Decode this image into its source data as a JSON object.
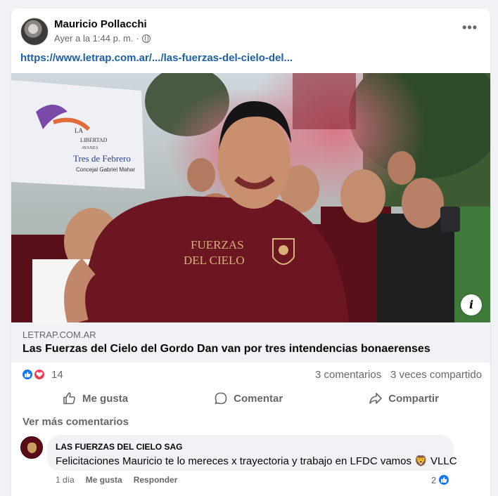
{
  "post": {
    "author": "Mauricio Pollacchi",
    "time": "Ayer a la 1:44 p. m.",
    "separator": "·",
    "privacy_icon": "globe-icon",
    "menu_icon": "more-options-icon",
    "link_text": "https://www.letrap.com.ar/.../las-fuerzas-del-cielo-del..."
  },
  "image": {
    "banner_lines": [
      "LA",
      "LIBERTAD",
      "AVANZA",
      "Tres de Febrero",
      "Concejal Gabriel Mahar"
    ],
    "shirt_text_line1": "FUERZAS",
    "shirt_text_line2": "DEL CIELO",
    "info_label": "i"
  },
  "preview": {
    "domain": "LETRAP.COM.AR",
    "title": "Las Fuerzas del Cielo del Gordo Dan van por tres intendencias bonaerenses"
  },
  "stats": {
    "reactions": [
      "like",
      "love"
    ],
    "reaction_count": "14",
    "comments": "3 comentarios",
    "shares": "3 veces compartido"
  },
  "actions": {
    "like": "Me gusta",
    "comment": "Comentar",
    "share": "Compartir"
  },
  "comments": {
    "more_label": "Ver más comentarios",
    "items": [
      {
        "name": "LAS FUERZAS DEL CIELO SAG",
        "text": "Felicitaciones Mauricio te lo mereces x trayectoria y trabajo en LFDC vamos 🦁 VLLC",
        "time": "1 día",
        "like": "Me gusta",
        "reply": "Responder",
        "reactions": "2"
      }
    ]
  },
  "colors": {
    "link": "#1d5fa8",
    "like_blue": "#1877f2",
    "love_red": "#f33e58",
    "muted": "#65676b",
    "shirt": "#6b1620"
  }
}
